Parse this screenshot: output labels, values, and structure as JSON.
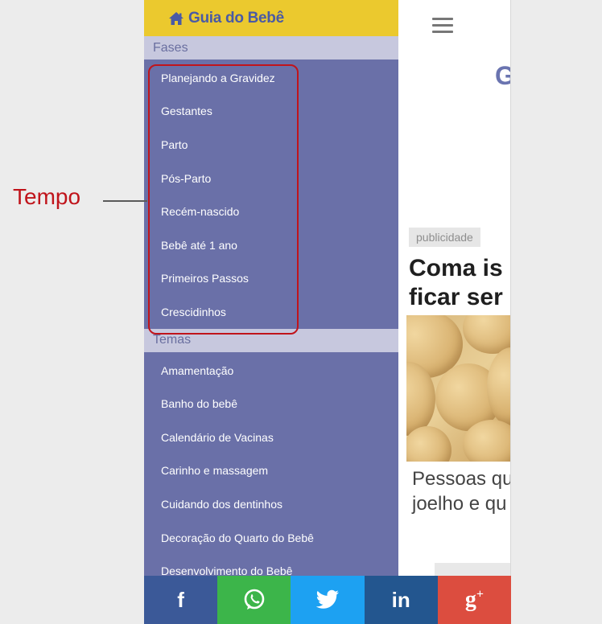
{
  "drawer": {
    "brand": "Guia do Bebê",
    "sections": [
      {
        "title": "Fases",
        "items": [
          "Planejando a Gravidez",
          "Gestantes",
          "Parto",
          "Pós-Parto",
          "Recém-nascido",
          "Bebê até 1 ano",
          "Primeiros Passos",
          "Crescidinhos"
        ]
      },
      {
        "title": "Temas",
        "items": [
          "Amamentação",
          "Banho do bebê",
          "Calendário de Vacinas",
          "Carinho e massagem",
          "Cuidando dos dentinhos",
          "Decoração do Quarto do Bebê",
          "Desenvolvimento do Bebê"
        ]
      }
    ]
  },
  "main": {
    "site_letter": "G",
    "ad_label": "publicidade",
    "headline_lines": [
      "Coma is",
      "ficar ser"
    ],
    "ad_text_lines": [
      "Pessoas qu",
      "joelho e qu"
    ]
  },
  "social": [
    "f",
    "whatsapp",
    "twitter",
    "in",
    "g+"
  ],
  "annotation": {
    "label": "Tempo"
  },
  "colors": {
    "drawer_bg": "#6a70a8",
    "header_bg": "#ebc92e",
    "section_bg": "#c7c8de",
    "annotation": "#c0141b"
  }
}
